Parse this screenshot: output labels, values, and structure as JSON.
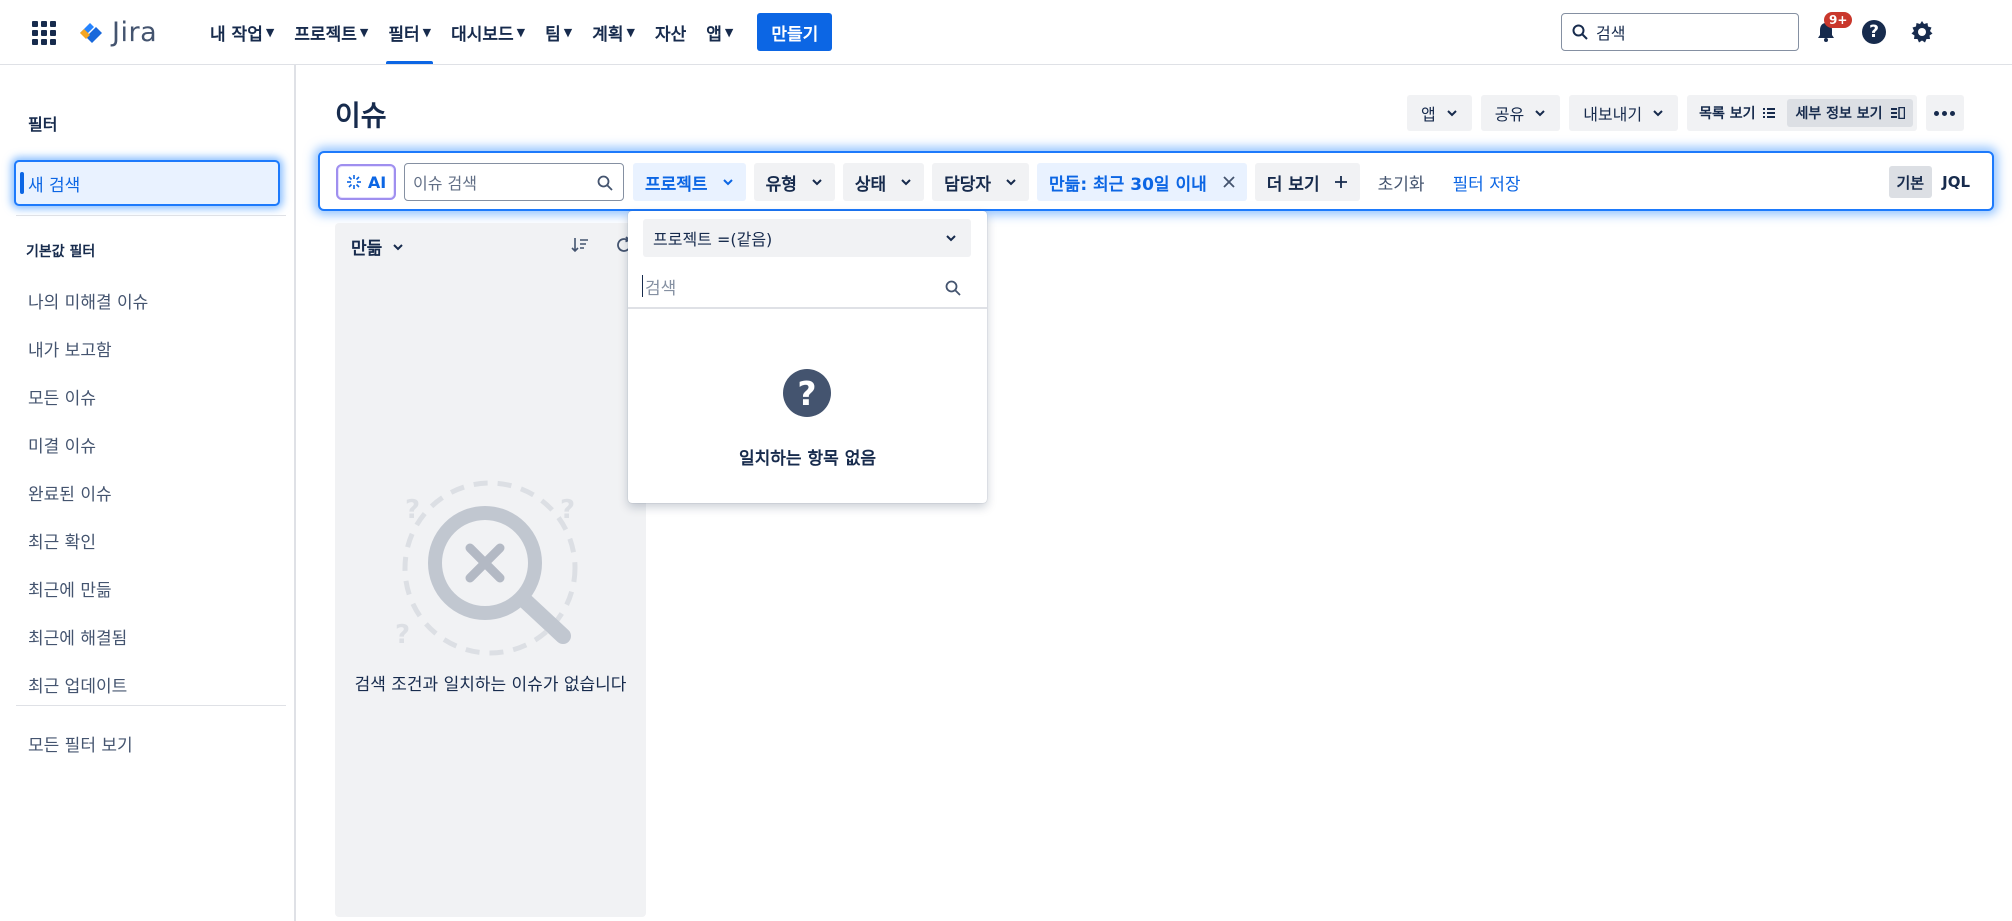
{
  "nav": {
    "app_name": "Jira",
    "items": [
      {
        "label": "내 작업"
      },
      {
        "label": "프로젝트"
      },
      {
        "label": "필터"
      },
      {
        "label": "대시보드"
      },
      {
        "label": "팀"
      },
      {
        "label": "계획"
      },
      {
        "label": "자산"
      },
      {
        "label": "앱"
      }
    ],
    "active_item": "필터",
    "create_label": "만들기",
    "search_placeholder": "검색",
    "notifications_badge": "9+"
  },
  "sidebar": {
    "heading": "필터",
    "new_search": "새 검색",
    "default_filters_heading": "기본값 필터",
    "items": [
      {
        "label": "나의 미해결 이슈"
      },
      {
        "label": "내가 보고함"
      },
      {
        "label": "모든 이슈"
      },
      {
        "label": "미결 이슈"
      },
      {
        "label": "완료된 이슈"
      },
      {
        "label": "최근 확인"
      },
      {
        "label": "최근에 만듦"
      },
      {
        "label": "최근에 해결됨"
      },
      {
        "label": "최근 업데이트"
      }
    ],
    "view_all": "모든 필터 보기"
  },
  "main": {
    "title": "이슈",
    "actions": {
      "apps": "앱",
      "share": "공유",
      "export": "내보내기",
      "list_view": "목록 보기",
      "detail_view": "세부 정보 보기"
    },
    "filterbar": {
      "ai_label": "AI",
      "search_placeholder": "이슈 검색",
      "chips": {
        "project": "프로젝트",
        "type": "유형",
        "status": "상태",
        "assignee": "담당자",
        "created": "만듦: 최근 30일 이내",
        "more": "더 보기"
      },
      "reset": "초기화",
      "save_filter": "필터 저장",
      "mode_basic": "기본",
      "mode_jql": "JQL"
    },
    "list": {
      "sort_label": "만듦",
      "empty_text": "검색 조건과 일치하는 이슈가 없습니다"
    },
    "dropdown": {
      "operator": "프로젝트 =(같음)",
      "search_placeholder": "검색",
      "empty_text": "일치하는 항목 없음"
    }
  }
}
